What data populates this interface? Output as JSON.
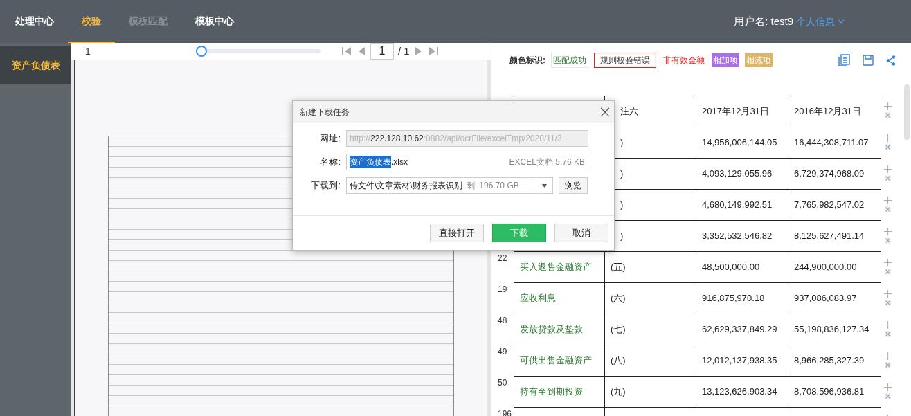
{
  "nav": {
    "tabs": [
      {
        "label": "处理中心",
        "selected": false,
        "disabled": false
      },
      {
        "label": "校验",
        "selected": true,
        "disabled": false
      },
      {
        "label": "模板匹配",
        "selected": false,
        "disabled": true
      },
      {
        "label": "模板中心",
        "selected": false,
        "disabled": false
      }
    ],
    "user_label": "用户名: test9",
    "profile_link": "个人信息"
  },
  "sidebar": {
    "items": [
      {
        "label": "资产负债表",
        "selected": true
      }
    ]
  },
  "viewer": {
    "page_label": "1",
    "zoom_slider": {
      "level": 0
    },
    "page_input": "1",
    "page_total": "/ 1"
  },
  "legend": {
    "title": "颜色标识:",
    "items": [
      {
        "kind": "matched",
        "label": "匹配成功"
      },
      {
        "kind": "rule_error",
        "label": "规则校验错误"
      },
      {
        "kind": "invalid",
        "label": "非有效金额"
      },
      {
        "kind": "add",
        "label": "相加项"
      },
      {
        "kind": "subtract",
        "label": "相减项"
      }
    ]
  },
  "table": {
    "header": {
      "note": "注六",
      "y2017": "2017年12月31日",
      "y2016": "2016年12月31日"
    },
    "rows": [
      {
        "note": ")",
        "y2017": "14,956,006,144.05",
        "y2016": "16,444,308,711.07"
      },
      {
        "note": ")",
        "y2017": "4,093,129,055.96",
        "y2016": "6,729,374,968.09"
      },
      {
        "note": ")",
        "y2017": "4,680,149,992.51",
        "y2016": "7,765,982,547.02"
      },
      {
        "note": ")",
        "y2017": "3,352,532,546.82",
        "y2016": "8,125,627,491.14"
      },
      {
        "line": "22",
        "item": "买入返售金融资产",
        "note": "(五)",
        "y2017": "48,500,000.00",
        "y2016": "244,900,000.00"
      },
      {
        "line": "19",
        "item": "应收利息",
        "note": "(六)",
        "y2017": "916,875,970.18",
        "y2016": "937,086,083.97"
      },
      {
        "line": "48",
        "item": "发放贷款及垫款",
        "note": "(七)",
        "y2017": "62,629,337,849.29",
        "y2016": "55,198,836,127.34"
      },
      {
        "line": "49",
        "item": "可供出售金融资产",
        "note": "(八)",
        "y2017": "12,012,137,938.35",
        "y2016": "8,966,285,327.39"
      },
      {
        "line": "50",
        "item": "持有至到期投资",
        "note": "(九)",
        "y2017": "13,123,626,903.34",
        "y2016": "8,708,596,936.81"
      },
      {
        "line": "196"
      }
    ]
  },
  "dialog": {
    "title": "新建下载任务",
    "url_label": "网址:",
    "url_scheme": "http://",
    "url_host": "222.128.10.62",
    "url_rest": ":8882/api/ocrFile/excelTmp/2020/11/3",
    "name_label": "名称:",
    "name_selected": "资产负债表",
    "name_ext": ".xlsx",
    "file_info": "EXCEL文档 5.76 KB",
    "save_label": "下载到:",
    "save_path": "传文件\\文章素材\\财务报表识别",
    "free_space": "剩: 196.70 GB",
    "browse": "浏览",
    "buttons": [
      {
        "kind": "plain",
        "label": "直接打开"
      },
      {
        "kind": "primary",
        "label": "下载"
      },
      {
        "kind": "plain",
        "label": "取消"
      }
    ]
  }
}
